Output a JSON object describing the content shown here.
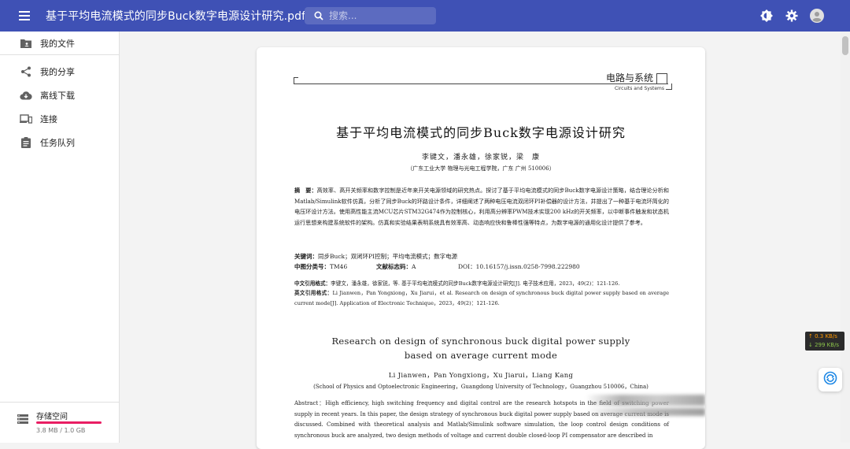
{
  "topbar": {
    "title": "基于平均电流模式的同步Buck数字电源设计研究.pdf",
    "search_placeholder": "搜索..."
  },
  "sidebar": {
    "items": [
      {
        "label": "我的文件",
        "icon": "folder-icon"
      },
      {
        "label": "我的分享",
        "icon": "share-icon"
      },
      {
        "label": "离线下载",
        "icon": "cloud-download-icon"
      },
      {
        "label": "连接",
        "icon": "devices-icon"
      },
      {
        "label": "任务队列",
        "icon": "task-list-icon"
      }
    ],
    "storage": {
      "title": "存储空间",
      "usage": "3.8 MB / 1.0 GB",
      "fraction": 0.0037
    }
  },
  "document": {
    "journal_cn": "电路与系统",
    "journal_en": "Circuits and Systems",
    "title_cn": "基于平均电流模式的同步Buck数字电源设计研究",
    "authors_cn": "李键文，潘永雄，徐家锐，梁　康",
    "affiliation_cn": "（广东工业大学 物理与光电工程学院，广东 广州 510006）",
    "abstract_label": "摘　要：",
    "abstract_cn": "高效率、高开关频率和数字控制是近年来开关电源领域的研究热点。探讨了基于平均电流模式的同步Buck数字电源设计策略，结合理论分析和Matlab/Simulink软件仿真，分析了同步Buck的环路设计条件，详细阐述了两种电压电流双闭环PI补偿器的设计方法，并提出了一种基于电流环简化的电压环设计方法。使用高性能主流MCU芯片STM32G474作为控制核心，利用高分辨率PWM技术实现200 kHz的开关频率，以中断事件触发和状态机运行思想来构建系统软件的架构。仿真和实验结果表明系统具有效率高、动态响应快和鲁棒性强等特点，为数字电源的通用化设计提供了参考。",
    "keywords_label": "关键词：",
    "keywords": "同步Buck；双闭环PI控制；平均电流模式；数字电源",
    "clc_label": "中图分类号：",
    "clc": "TM46",
    "doccode_label": "文献标志码：",
    "doccode": "A",
    "doi_label": "DOI：",
    "doi": "10.16157/j.issn.0258-7998.222980",
    "cite_cn_label": "中文引用格式：",
    "cite_cn": "李键文，潘永雄，徐家锐，等. 基于平均电流模式的同步Buck数字电源设计研究[J]. 电子技术应用，2023，49(2)：121-126.",
    "cite_en_label": "英文引用格式：",
    "cite_en": "Li Jianwen，Pan Yongxiong，Xu Jiarui，et al. Research on design of synchronous buck digital power supply based on average current mode[J]. Application of Electronic Technique，2023，49(2)：121-126.",
    "title_en_line1": "Research on design of synchronous buck digital power supply",
    "title_en_line2": "based on average current mode",
    "authors_en": "Li Jianwen，Pan Yongxiong，Xu Jiarui，Liang Kang",
    "affiliation_en": "(School of Physics and Optoelectronic Engineering，Guangdong University of Technology，Guangzhou 510006，China)",
    "abstract_en_label": "Abstract：",
    "abstract_en": "High efficiency, high switching frequency and digital control are the research hotspots in the field of switching power supply in recent years. In this paper, the design strategy of synchronous buck digital power supply based on average current mode is discussed. Combined with theoretical analysis and Matlab/Simulink software simulation, the loop control design conditions of synchronous buck are analyzed, two design methods of voltage and current double closed-loop PI compensator are described in"
  },
  "netspeed": {
    "up": "↑ 0.3 KB/s",
    "down": "↓ 299 KB/s"
  },
  "colors": {
    "primary": "#3f51b5",
    "storage_bar": "#e91e63"
  }
}
